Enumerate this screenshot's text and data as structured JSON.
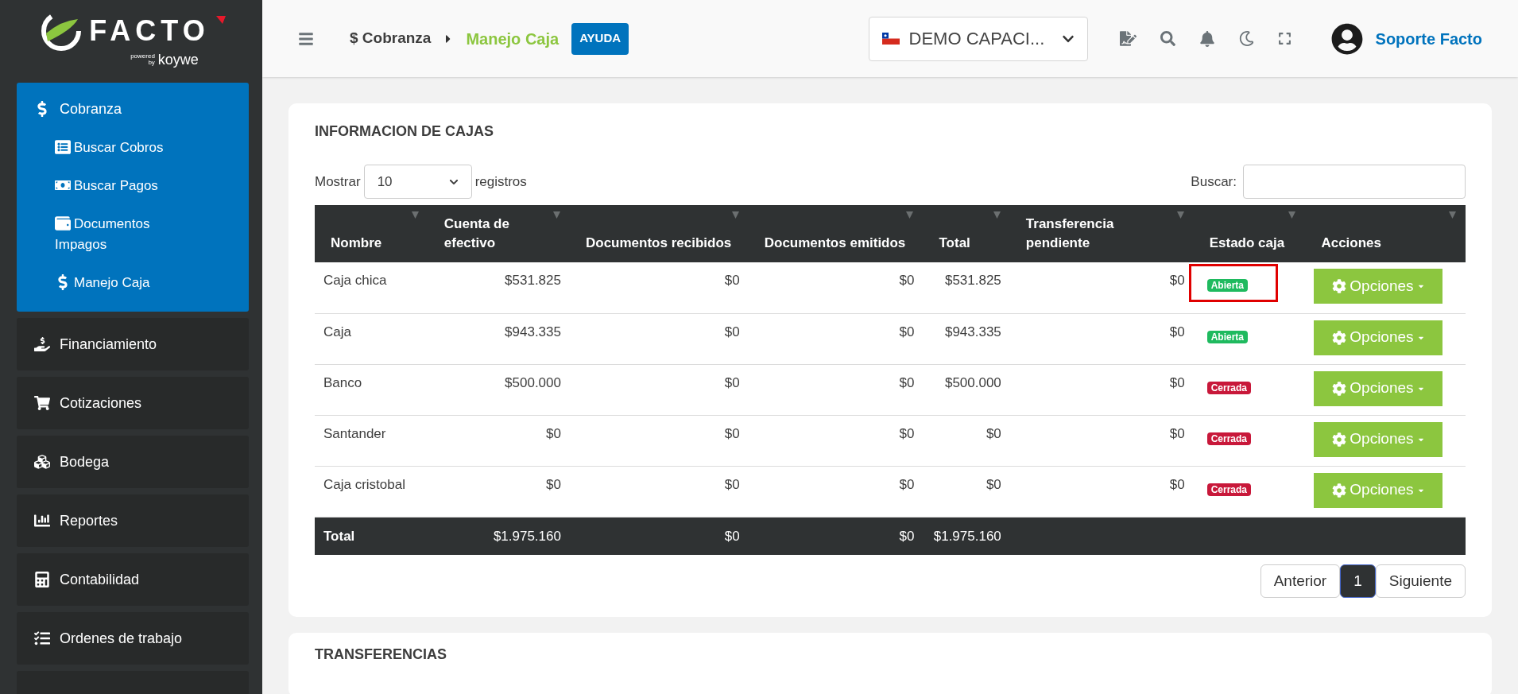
{
  "sidebar": {
    "logo": {
      "name": "FACTO",
      "powered": "powered",
      "by": "by",
      "brand": "koywe"
    },
    "items": [
      {
        "label": "Cobranza",
        "selected": true,
        "children": [
          {
            "label": "Buscar Cobros"
          },
          {
            "label": "Buscar Pagos"
          },
          {
            "label": "Documentos Impagos"
          },
          {
            "label": "Manejo Caja"
          }
        ]
      },
      {
        "label": "Financiamiento",
        "selected": false
      },
      {
        "label": "Cotizaciones",
        "selected": false
      },
      {
        "label": "Bodega",
        "selected": false
      },
      {
        "label": "Reportes",
        "selected": false
      },
      {
        "label": "Contabilidad",
        "selected": false
      },
      {
        "label": "Ordenes de trabajo",
        "selected": false
      }
    ]
  },
  "header": {
    "breadcrumb": [
      "$ Cobranza",
      "Manejo Caja"
    ],
    "help": "AYUDA",
    "company": "DEMO CAPACI...",
    "user": "Soporte Facto"
  },
  "card": {
    "title": "INFORMACION DE CAJAS",
    "show_label": "Mostrar",
    "page_size": "10",
    "records_label": "registros",
    "search_label": "Buscar:",
    "columns": [
      "Nombre",
      "Cuenta de efectivo",
      "Documentos recibidos",
      "Documentos emitidos",
      "Total",
      "Transferencia pendiente",
      "Estado caja",
      "Acciones"
    ],
    "rows": [
      {
        "cells": [
          "Caja chica",
          "$531.825",
          "$0",
          "$0",
          "$531.825",
          "$0"
        ],
        "status": {
          "label": "Abierta",
          "kind": "open"
        },
        "highlighted": true,
        "action": "Opciones"
      },
      {
        "cells": [
          "Caja",
          "$943.335",
          "$0",
          "$0",
          "$943.335",
          "$0"
        ],
        "status": {
          "label": "Abierta",
          "kind": "open"
        },
        "highlighted": false,
        "action": "Opciones"
      },
      {
        "cells": [
          "Banco",
          "$500.000",
          "$0",
          "$0",
          "$500.000",
          "$0"
        ],
        "status": {
          "label": "Cerrada",
          "kind": "closed"
        },
        "highlighted": false,
        "action": "Opciones"
      },
      {
        "cells": [
          "Santander",
          "$0",
          "$0",
          "$0",
          "$0",
          "$0"
        ],
        "status": {
          "label": "Cerrada",
          "kind": "closed"
        },
        "highlighted": false,
        "action": "Opciones"
      },
      {
        "cells": [
          "Caja cristobal",
          "$0",
          "$0",
          "$0",
          "$0",
          "$0"
        ],
        "status": {
          "label": "Cerrada",
          "kind": "closed"
        },
        "highlighted": false,
        "action": "Opciones"
      }
    ],
    "footer": [
      "Total",
      "$1.975.160",
      "$0",
      "$0",
      "$1.975.160"
    ],
    "pagination": [
      {
        "label": "Anterior",
        "selected": false
      },
      {
        "label": "1",
        "selected": true
      },
      {
        "label": "Siguiente",
        "selected": false
      }
    ]
  },
  "second_card": {
    "title": "TRANSFERENCIAS"
  }
}
